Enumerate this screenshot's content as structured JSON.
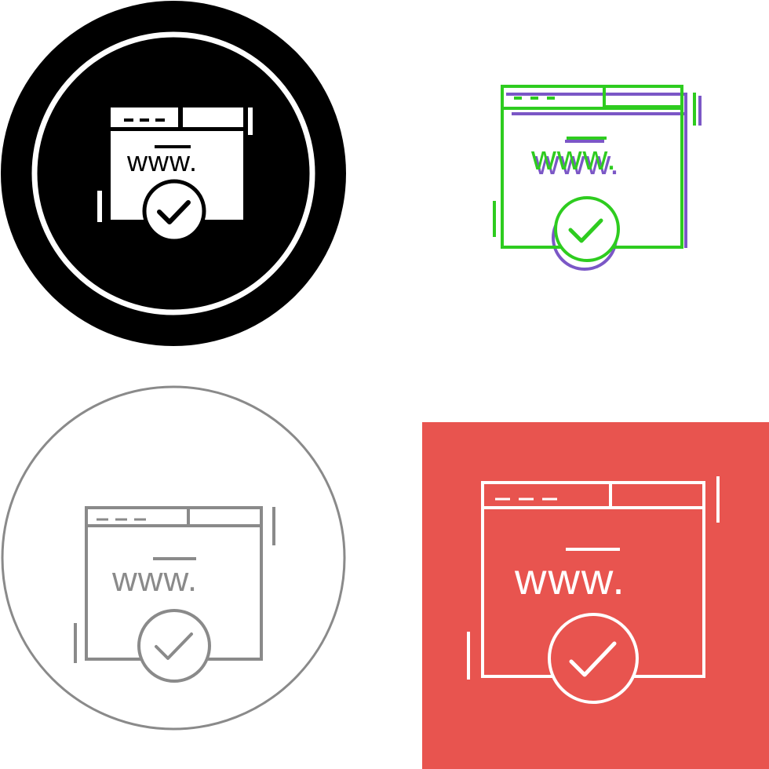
{
  "icons": [
    {
      "id": "glyph",
      "style": "glyph",
      "label": "www.",
      "colors": {
        "background": "#000000",
        "ring": "#ffffff",
        "foreground": "#ffffff"
      },
      "icon_names": [
        "browser-window-icon",
        "check-circle-icon"
      ]
    },
    {
      "id": "duotone",
      "style": "duotone",
      "label": "www.",
      "colors": {
        "primary": "#2ecc1f",
        "secondary": "#7b57c6",
        "fill": "#ffffff"
      },
      "icon_names": [
        "browser-window-icon",
        "check-circle-icon"
      ]
    },
    {
      "id": "outline",
      "style": "outline",
      "label": "www.",
      "colors": {
        "ring": "#8a8a8a",
        "stroke": "#8a8a8a"
      },
      "icon_names": [
        "browser-window-icon",
        "check-circle-icon"
      ]
    },
    {
      "id": "flat-square",
      "style": "flat",
      "label": "www.",
      "colors": {
        "background": "#e8544f",
        "stroke": "#ffffff"
      },
      "icon_names": [
        "browser-window-icon",
        "check-circle-icon"
      ]
    }
  ]
}
